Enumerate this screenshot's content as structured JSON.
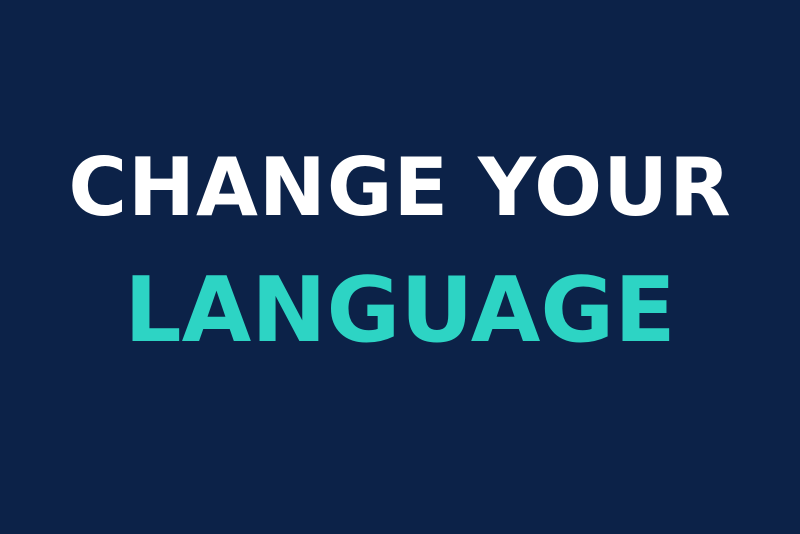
{
  "headline": {
    "line1": "CHANGE YOUR",
    "line2": "LANGUAGE"
  },
  "colors": {
    "background": "#0c2248",
    "line1": "#ffffff",
    "line2": "#2dd4c4"
  }
}
